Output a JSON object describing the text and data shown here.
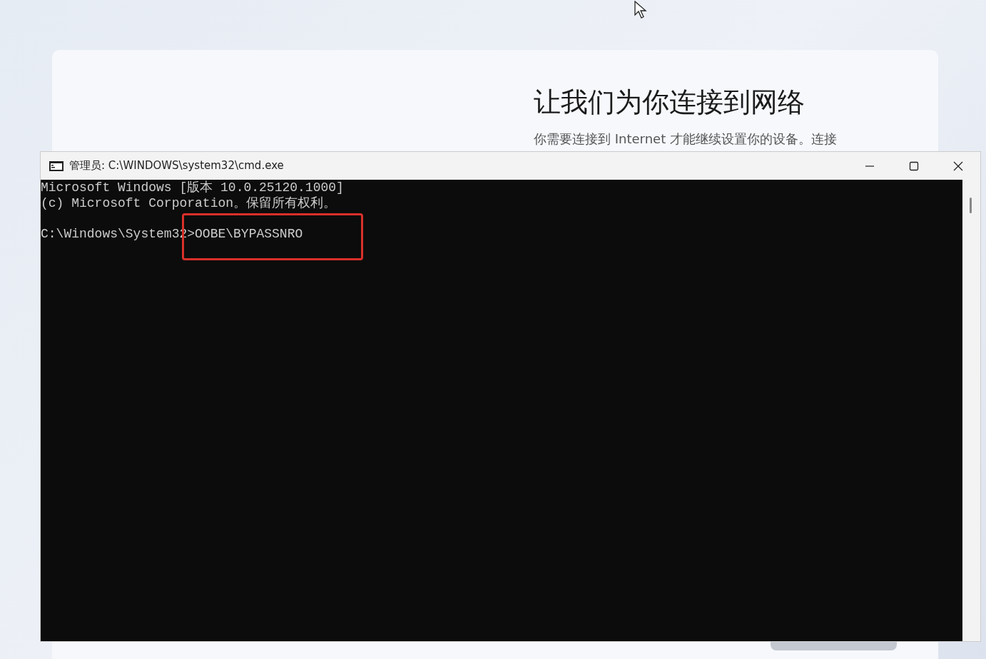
{
  "setup_page": {
    "title": "让我们为你连接到网络",
    "description": "你需要连接到 Internet 才能继续设置你的设备。连接"
  },
  "console_window": {
    "title": "管理员: C:\\WINDOWS\\system32\\cmd.exe",
    "lines": [
      "Microsoft Windows [版本 10.0.25120.1000]",
      "(c) Microsoft Corporation。保留所有权利。"
    ],
    "prompt": "C:\\Windows\\System32>OOBE\\BYPASSNRO"
  }
}
